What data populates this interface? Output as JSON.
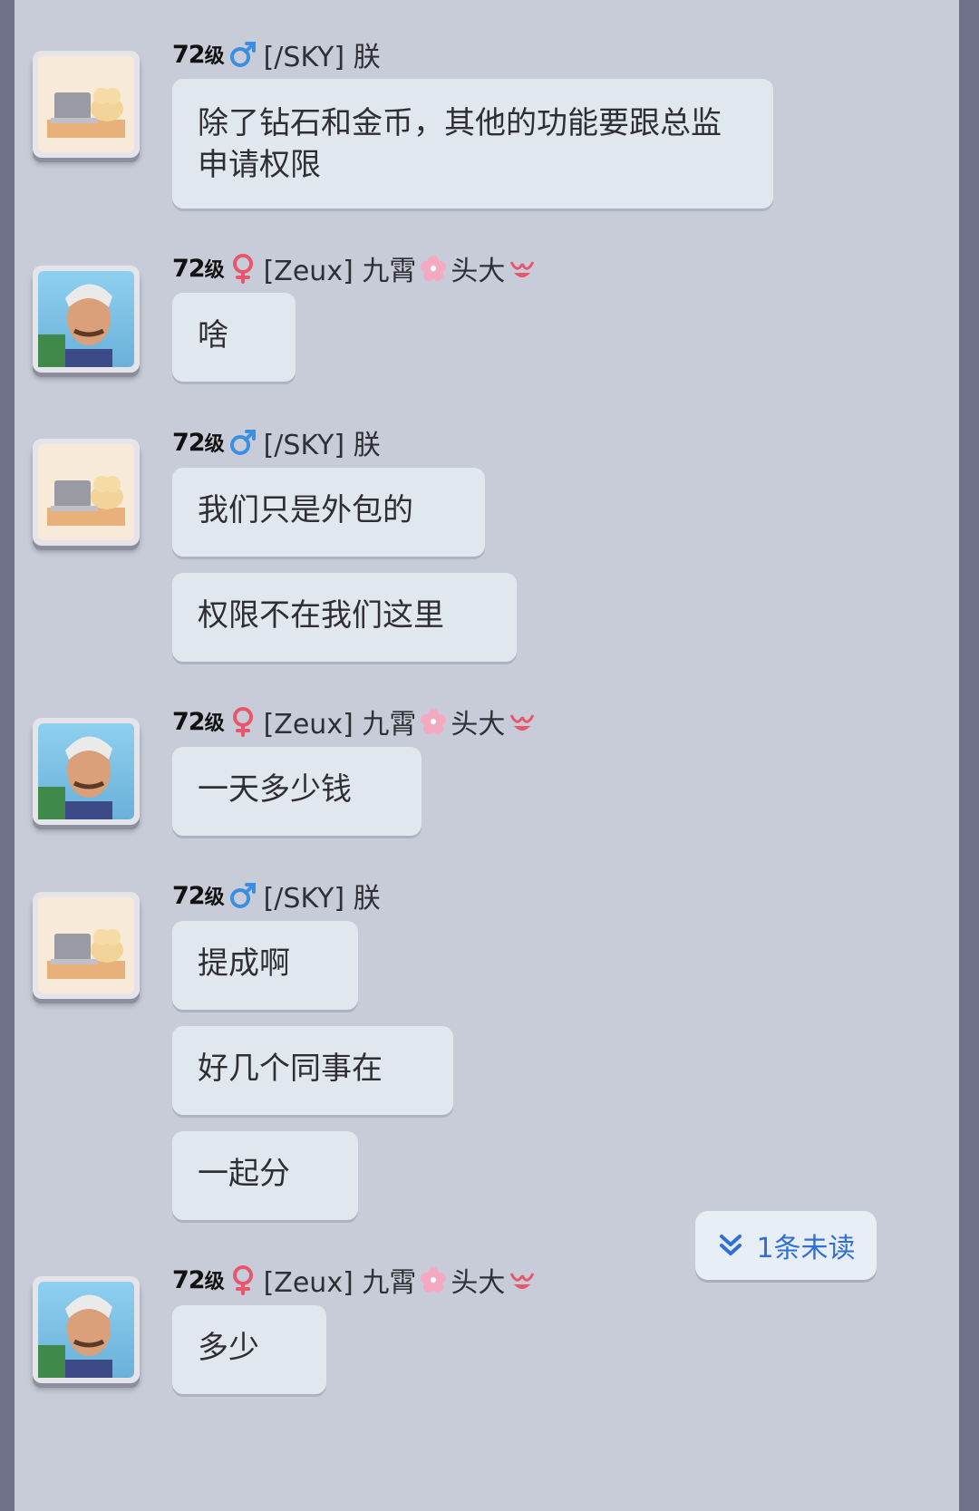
{
  "users": {
    "sky": {
      "level": "72",
      "level_suffix": "级",
      "gender": "male",
      "name": "[/SKY] 朕"
    },
    "zeux": {
      "level": "72",
      "level_suffix": "级",
      "gender": "female",
      "name_a": "[Zeux] 九霄",
      "name_b": "头大"
    }
  },
  "messages": [
    {
      "sender": "sky",
      "bubbles": [
        "除了钻石和金币，其他的功能要跟总监申请权限"
      ]
    },
    {
      "sender": "zeux",
      "bubbles": [
        "啥"
      ]
    },
    {
      "sender": "sky",
      "bubbles": [
        "我们只是外包的",
        "权限不在我们这里"
      ]
    },
    {
      "sender": "zeux",
      "bubbles": [
        "一天多少钱"
      ]
    },
    {
      "sender": "sky",
      "bubbles": [
        "提成啊",
        "好几个同事在",
        "一起分"
      ]
    },
    {
      "sender": "zeux",
      "bubbles": [
        "多少"
      ]
    }
  ],
  "unread_badge": {
    "label": "1条未读",
    "icon": "double-chevron-down-icon"
  },
  "colors": {
    "male": "#3a8fe0",
    "female": "#e8566e",
    "accent": "#2f6fd6"
  }
}
